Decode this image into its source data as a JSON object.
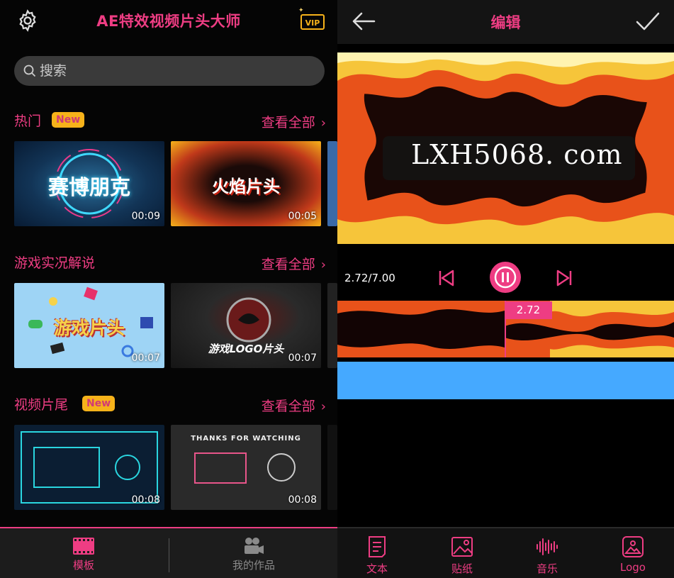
{
  "left": {
    "app_title": "AE特效视频片头大师",
    "vip_label": "VIP",
    "search": {
      "placeholder": "搜索"
    },
    "sections": [
      {
        "title": "热门",
        "badge": "New",
        "see_all": "查看全部",
        "items": [
          {
            "caption": "赛博朋克",
            "duration": "00:09"
          },
          {
            "caption": "火焰片头",
            "duration": "00:05"
          }
        ]
      },
      {
        "title": "游戏实况解说",
        "badge": "",
        "see_all": "查看全部",
        "items": [
          {
            "caption": "游戏片头",
            "duration": "00:07"
          },
          {
            "caption": "游戏LOGO片头",
            "duration": "00:07"
          }
        ]
      },
      {
        "title": "视频片尾",
        "badge": "New",
        "see_all": "查看全部",
        "items": [
          {
            "caption": "",
            "duration": "00:08"
          },
          {
            "caption": "THANKS FOR WATCHING",
            "duration": "00:08"
          }
        ]
      }
    ],
    "bottom_nav": [
      {
        "label": "模板",
        "icon": "film-icon",
        "active": true
      },
      {
        "label": "我的作品",
        "icon": "video-camera-icon",
        "active": false
      }
    ]
  },
  "right": {
    "title": "编辑",
    "watermark": "LXH5068. com",
    "time": "2.72/7.00",
    "playhead_label": "2.72",
    "tools": [
      {
        "label": "文本",
        "icon": "text-icon"
      },
      {
        "label": "贴纸",
        "icon": "sticker-icon"
      },
      {
        "label": "音乐",
        "icon": "music-wave-icon"
      },
      {
        "label": "Logo",
        "icon": "logo-icon"
      }
    ]
  },
  "colors": {
    "accent": "#ee3d83",
    "badge": "#f6b21a",
    "music_track": "#45a9ff"
  }
}
